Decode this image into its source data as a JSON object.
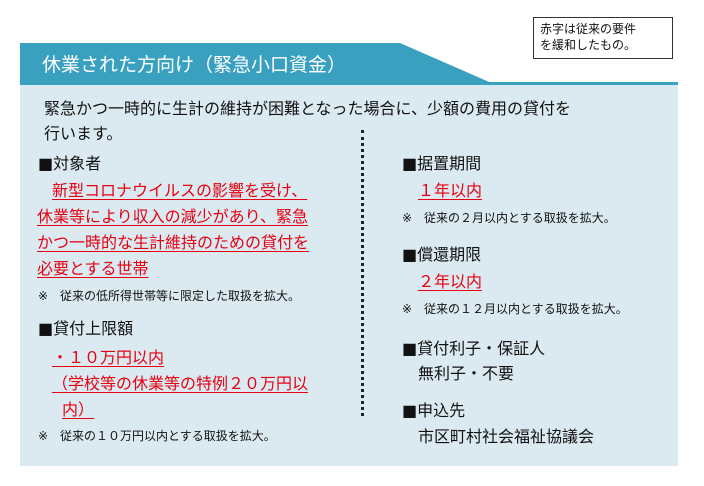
{
  "note": {
    "line1": "赤字は従来の要件",
    "line2": "を緩和したもの。"
  },
  "header": {
    "title": "休業された方向け（緊急小口資金）"
  },
  "intro": {
    "line1": "緊急かつ一時的に生計の維持が困難となった場合に、少額の費用の貸付を",
    "line2": "行います。"
  },
  "left": {
    "target": {
      "heading": "■対象者",
      "lines": [
        "新型コロナウイルスの影響を受け、",
        "休業等により収入の減少があり、緊急",
        "かつ一時的な生計維持のための貸付を",
        "必要とする世帯"
      ],
      "note": "※　従来の低所得世帯等に限定した取扱を拡大。"
    },
    "limit": {
      "heading": "■貸付上限額",
      "lines": [
        "・１０万円以内",
        "（学校等の休業等の特例２０万円以",
        "内）"
      ],
      "note": "※　従来の１０万円以内とする取扱を拡大。"
    }
  },
  "right": {
    "deferral": {
      "heading": "■据置期間",
      "value": "１年以内",
      "note": "※　従来の２月以内とする取扱を拡大。"
    },
    "repayment": {
      "heading": "■償還期限",
      "value": "２年以内",
      "note": "※　従来の１２月以内とする取扱を拡大。"
    },
    "interest": {
      "heading": "■貸付利子・保証人",
      "value": "無利子・不要"
    },
    "apply": {
      "heading": "■申込先",
      "value": "市区町村社会福祉協議会"
    }
  },
  "colors": {
    "header_bg": "#3aa0c0",
    "panel_bg": "#dbeaf0",
    "accent_red": "#e60012"
  }
}
